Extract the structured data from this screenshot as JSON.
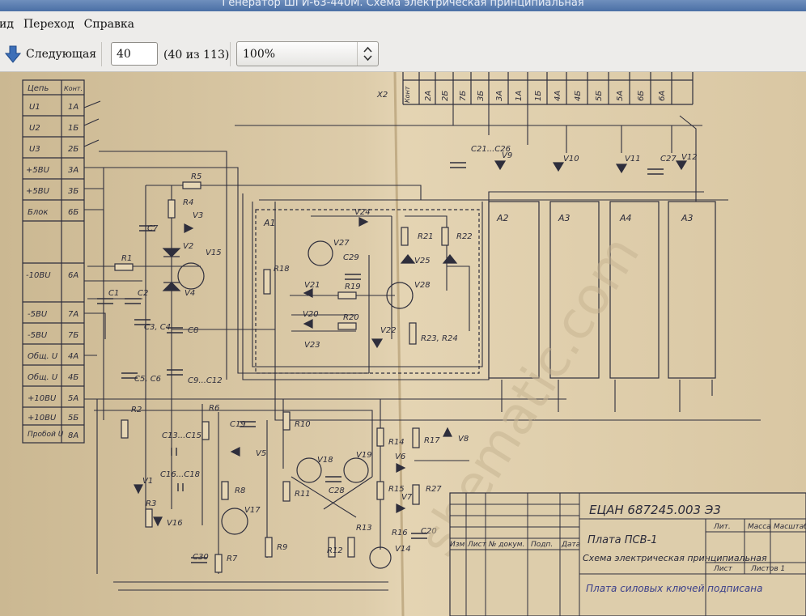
{
  "window": {
    "title": "Генератор ШГИ-63-440М. Схема электрическая принципиальная"
  },
  "menu": {
    "items": [
      "ид",
      "Переход",
      "Справка"
    ]
  },
  "toolbar": {
    "next_label": "Следующая",
    "page_value": "40",
    "page_count": "(40 из 113)",
    "zoom_value": "100%"
  },
  "schematic": {
    "table_header": {
      "col1": "Цепь",
      "col2": "Конт."
    },
    "table_rows": [
      {
        "name": "U1",
        "contact": "1А"
      },
      {
        "name": "U2",
        "contact": "1Б"
      },
      {
        "name": "U3",
        "contact": "2Б"
      },
      {
        "name": "+5ВU",
        "contact": "3А"
      },
      {
        "name": "+5ВU",
        "contact": "3Б"
      },
      {
        "name": "Блок",
        "contact": "6Б"
      },
      {
        "name": "-10ВU",
        "contact": "6А"
      },
      {
        "name": "-5ВU",
        "contact": "7А"
      },
      {
        "name": "-5ВU",
        "contact": "7Б"
      },
      {
        "name": "Общ. U",
        "contact": "4А"
      },
      {
        "name": "Общ. U",
        "contact": "4Б"
      },
      {
        "name": "+10ВU",
        "contact": "5А"
      },
      {
        "name": "+10ВU",
        "contact": "5Б"
      },
      {
        "name": "Пробой U",
        "contact": "8А"
      }
    ],
    "x2_label": "Х2",
    "x2_contacts": [
      "Конт",
      "2А",
      "2Б",
      "7Б",
      "3Б",
      "3А",
      "1А",
      "1Б",
      "4А",
      "4Б",
      "5Б",
      "5А",
      "6Б",
      "6А"
    ],
    "stamp_title": "ЕЦАН 687245.003 Э3",
    "stamp_product": "Плата ПСВ-1",
    "stamp_doc": "Схема электрическая принципиальная",
    "stamp_handwritten": "Плата силовых ключей подписана",
    "stamp_headers": [
      "Изм",
      "Лист",
      "№ докум.",
      "Подп.",
      "Дата"
    ],
    "stamp_lit": [
      "Лит.",
      "Масса",
      "Масштаб"
    ],
    "stamp_sheet": "Лист",
    "stamp_sheets": "Листов 1",
    "watermark": "shematic.com",
    "labels": {
      "A1": "А1",
      "A2": "А2",
      "A3a": "А3",
      "A4": "А4",
      "A3b": "А3",
      "R1": "R1",
      "R2": "R2",
      "R3": "R3",
      "R4": "R4",
      "R5": "R5",
      "R6": "R6",
      "R7": "R7",
      "R8": "R8",
      "R9": "R9",
      "R10": "R10",
      "R11": "R11",
      "R12": "R12",
      "R13": "R13",
      "R14": "R14",
      "R15": "R15",
      "R16": "R16",
      "R17": "R17",
      "R18": "R18",
      "R19": "R19",
      "R20": "R20",
      "R21": "R21",
      "R22": "R22",
      "R23": "R23, R24",
      "R27": "R27",
      "C1": "C1",
      "C2": "C2",
      "C3": "C3, C4",
      "C5": "C5, C6",
      "C7": "C7",
      "C8": "C8",
      "C9": "C9...C12",
      "C13": "C13...C15",
      "C16": "C16...C18",
      "C19": "C19",
      "C20": "C20",
      "C21": "C21...C26",
      "C27": "C27",
      "C28": "C28",
      "C29": "C29",
      "C30": "C30",
      "V1": "V1",
      "V2": "V2",
      "V3": "V3",
      "V4": "V4",
      "V5": "V5",
      "V6": "V6",
      "V7": "V7",
      "V8": "V8",
      "V9": "V9",
      "V10": "V10",
      "V11": "V11",
      "V12": "V12",
      "V14": "V14",
      "V15": "V15",
      "V16": "V16",
      "V17": "V17",
      "V18": "V18",
      "V19": "V19",
      "V20": "V20",
      "V21": "V21",
      "V22": "V22",
      "V23": "V23",
      "V24": "V24",
      "V25": "V25",
      "V27": "V27",
      "V28": "V28"
    }
  }
}
